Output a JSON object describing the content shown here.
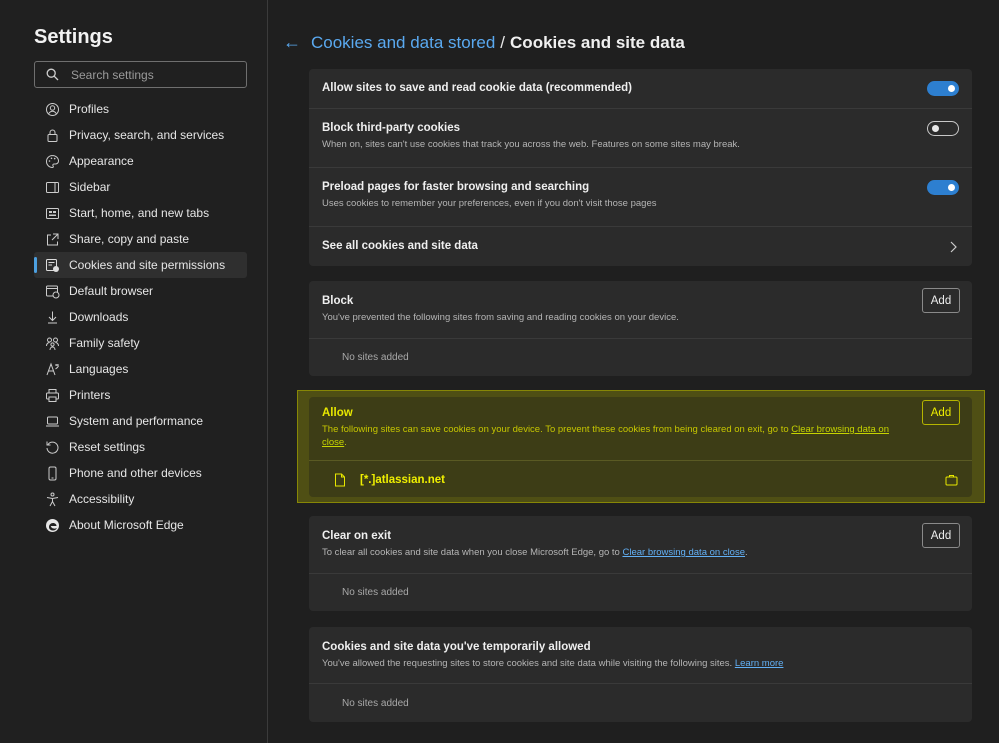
{
  "sidebar": {
    "title": "Settings",
    "search_placeholder": "Search settings",
    "items": [
      {
        "label": "Profiles",
        "icon": "profile-icon"
      },
      {
        "label": "Privacy, search, and services",
        "icon": "lock-icon"
      },
      {
        "label": "Appearance",
        "icon": "appearance-icon"
      },
      {
        "label": "Sidebar",
        "icon": "sidebar-icon"
      },
      {
        "label": "Start, home, and new tabs",
        "icon": "home-icon"
      },
      {
        "label": "Share, copy and paste",
        "icon": "share-icon"
      },
      {
        "label": "Cookies and site permissions",
        "icon": "cookie-permissions-icon",
        "active": true
      },
      {
        "label": "Default browser",
        "icon": "browser-icon"
      },
      {
        "label": "Downloads",
        "icon": "download-icon"
      },
      {
        "label": "Family safety",
        "icon": "family-icon"
      },
      {
        "label": "Languages",
        "icon": "language-icon"
      },
      {
        "label": "Printers",
        "icon": "printer-icon"
      },
      {
        "label": "System and performance",
        "icon": "laptop-icon"
      },
      {
        "label": "Reset settings",
        "icon": "reset-icon"
      },
      {
        "label": "Phone and other devices",
        "icon": "phone-icon"
      },
      {
        "label": "Accessibility",
        "icon": "accessibility-icon"
      },
      {
        "label": "About Microsoft Edge",
        "icon": "edge-logo-icon"
      }
    ]
  },
  "header": {
    "back_icon": "back-arrow-icon",
    "parent": "Cookies and data stored",
    "separator": "/",
    "current": "Cookies and site data"
  },
  "settings": {
    "allow_cookies": {
      "title": "Allow sites to save and read cookie data (recommended)",
      "enabled": true
    },
    "block_third_party": {
      "title": "Block third-party cookies",
      "desc": "When on, sites can't use cookies that track you across the web. Features on some sites may break.",
      "enabled": false
    },
    "preload": {
      "title": "Preload pages for faster browsing and searching",
      "desc": "Uses cookies to remember your preferences, even if you don't visit those pages",
      "enabled": true
    },
    "see_all": {
      "title": "See all cookies and site data"
    }
  },
  "block": {
    "title": "Block",
    "desc": "You've prevented the following sites from saving and reading cookies on your device.",
    "add_label": "Add",
    "empty": "No sites added"
  },
  "allow": {
    "title": "Allow",
    "desc_before": "The following sites can save cookies on your device. To prevent these cookies from being cleared on exit, go to ",
    "desc_link": "Clear browsing data on close",
    "desc_after": ".",
    "add_label": "Add",
    "sites": [
      "[*.]atlassian.net"
    ]
  },
  "clear_on_exit": {
    "title": "Clear on exit",
    "desc_before": "To clear all cookies and site data when you close Microsoft Edge, go to ",
    "desc_link": "Clear browsing data on close",
    "desc_after": ".",
    "add_label": "Add",
    "empty": "No sites added"
  },
  "temp_allowed": {
    "title": "Cookies and site data you've temporarily allowed",
    "desc_before": "You've allowed the requesting sites to store cookies and site data while visiting the following sites. ",
    "desc_link": "Learn more",
    "empty": "No sites added"
  },
  "colors": {
    "accent": "#2d7fd0",
    "link": "#62b0f5",
    "highlight": "#e8e800"
  }
}
